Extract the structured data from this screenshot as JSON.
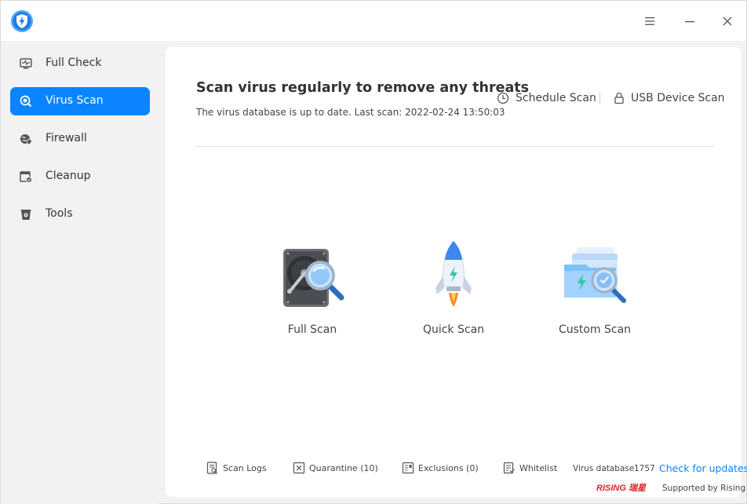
{
  "app": {
    "logo_icon": "shield-lightning-icon",
    "accent_color": "#0a84ff"
  },
  "window_controls": {
    "menu_icon": "hamburger-icon",
    "minimize_icon": "minimize-icon",
    "close_icon": "close-icon"
  },
  "sidebar": {
    "items": [
      {
        "label": "Full Check",
        "icon": "monitor-pulse-icon",
        "active": false
      },
      {
        "label": "Virus Scan",
        "icon": "scan-search-icon",
        "active": true
      },
      {
        "label": "Firewall",
        "icon": "globe-shield-icon",
        "active": false
      },
      {
        "label": "Cleanup",
        "icon": "broom-window-icon",
        "active": false
      },
      {
        "label": "Tools",
        "icon": "toolbox-icon",
        "active": false
      }
    ]
  },
  "main": {
    "headline": "Scan virus regularly to remove any threats",
    "status": "The virus database is up to date. Last scan: 2022-02-24 13:50:03",
    "schedule_scan": "Schedule Scan",
    "usb_scan": "USB Device Scan",
    "scan_modes": [
      {
        "label": "Full Scan",
        "icon": "hard-drive-magnifier-icon"
      },
      {
        "label": "Quick Scan",
        "icon": "rocket-icon"
      },
      {
        "label": "Custom Scan",
        "icon": "folder-magnifier-icon"
      }
    ]
  },
  "footer": {
    "scan_logs": "Scan Logs",
    "quarantine": "Quarantine (10)",
    "exclusions": "Exclusions (0)",
    "whitelist": "Whitelist",
    "virus_db_label": "Virus database",
    "virus_db_count": "1757",
    "check_updates": "Check for updates",
    "rising_logo": "RISING 瑞星",
    "supported_by": "Supported by Rising"
  }
}
